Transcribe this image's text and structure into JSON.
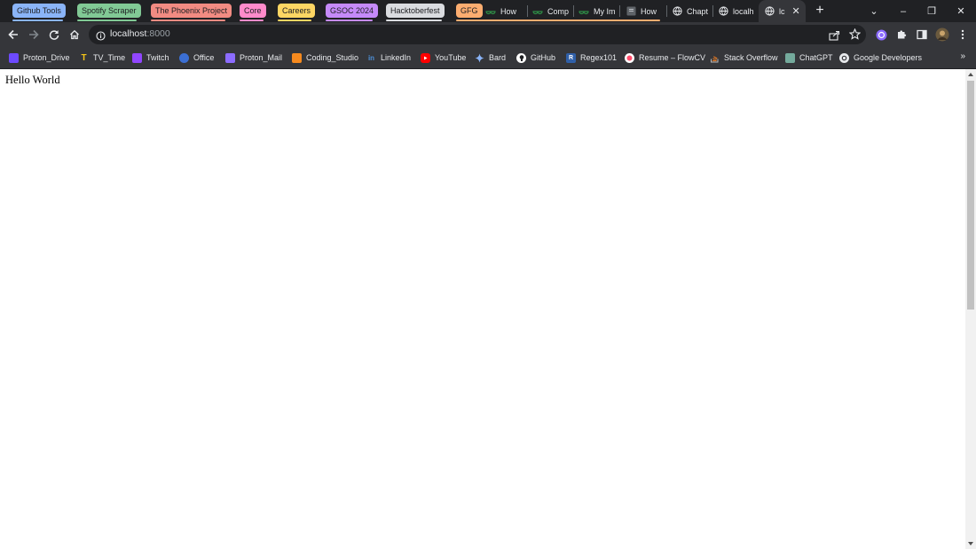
{
  "tab_groups": [
    {
      "label": "Github Tools",
      "color": "#8ab4f8"
    },
    {
      "label": "Spotify Scraper",
      "color": "#81c995"
    },
    {
      "label": "The Phoenix Project",
      "color": "#f28b82"
    },
    {
      "label": "Core",
      "color": "#ff8bcb"
    },
    {
      "label": "Careers",
      "color": "#fdd663"
    },
    {
      "label": "GSOC 2024",
      "color": "#c58af9"
    },
    {
      "label": "Hacktoberfest",
      "color": "#dadce0"
    },
    {
      "label": "GFG",
      "color": "#fcad70"
    }
  ],
  "tabs": [
    {
      "title": "How",
      "icon": "gfg-icon"
    },
    {
      "title": "Comp",
      "icon": "gfg-icon"
    },
    {
      "title": "My Im",
      "icon": "gfg-icon"
    },
    {
      "title": "How",
      "icon": "page-icon"
    },
    {
      "title": "Chapt",
      "icon": "globe-icon"
    },
    {
      "title": "localh",
      "icon": "globe-icon"
    },
    {
      "title": "lc",
      "icon": "globe-icon",
      "active": true
    }
  ],
  "new_tab_label": "+",
  "window_controls": {
    "tab_search": "⌄",
    "minimize": "–",
    "restore": "❐",
    "close": "✕"
  },
  "toolbar": {
    "url_host": "localhost",
    "url_port": ":8000"
  },
  "bookmarks": [
    {
      "label": "Proton_Drive",
      "icon": "proton-drive-icon",
      "color": "#6d4aff"
    },
    {
      "label": "TV_Time",
      "icon": "tv-time-icon",
      "color": "#f5c518"
    },
    {
      "label": "Twitch",
      "icon": "twitch-icon",
      "color": "#9146ff"
    },
    {
      "label": "Office",
      "icon": "office-icon",
      "color": "#3b6fd4"
    },
    {
      "label": "Proton_Mail",
      "icon": "proton-mail-icon",
      "color": "#8c6cff"
    },
    {
      "label": "Coding_Studio",
      "icon": "coding-studio-icon",
      "color": "#f68a1e"
    },
    {
      "label": "LinkedIn",
      "icon": "linkedin-icon",
      "color": "#0a66c2"
    },
    {
      "label": "YouTube",
      "icon": "youtube-icon",
      "color": "#ff0000"
    },
    {
      "label": "Bard",
      "icon": "bard-icon",
      "color": "#8ab4f8"
    },
    {
      "label": "GitHub",
      "icon": "github-icon",
      "color": "#ffffff"
    },
    {
      "label": "Regex101",
      "icon": "regex101-icon",
      "color": "#2f5fa8"
    },
    {
      "label": "Resume – FlowCV",
      "icon": "flowcv-icon",
      "color": "#ff4d6d"
    },
    {
      "label": "Stack Overflow",
      "icon": "stack-overflow-icon",
      "color": "#f48024"
    },
    {
      "label": "ChatGPT",
      "icon": "chatgpt-icon",
      "color": "#74aa9c"
    },
    {
      "label": "Google Developers",
      "icon": "google-developers-icon",
      "color": "#e8eaed"
    }
  ],
  "bookmarks_more": "»",
  "page": {
    "body_text": "Hello World"
  }
}
